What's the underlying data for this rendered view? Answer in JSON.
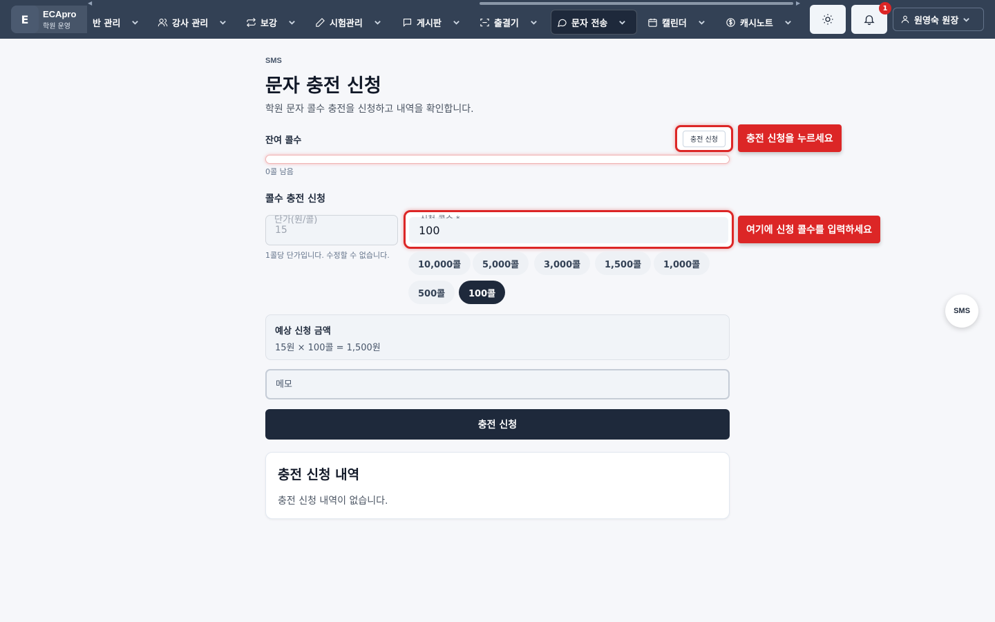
{
  "app": {
    "logo_letter": "E",
    "name": "ECApro",
    "subtitle": "학원 운영",
    "nav_left_arrow": "◀",
    "nav_right_arrow": "▶"
  },
  "nav": {
    "items": [
      {
        "label": "반 관리",
        "icon": "class-icon"
      },
      {
        "label": "강사 관리",
        "icon": "users-icon"
      },
      {
        "label": "보강",
        "icon": "repeat-icon"
      },
      {
        "label": "시험관리",
        "icon": "pencil-icon"
      },
      {
        "label": "게시판",
        "icon": "chat-square-icon"
      },
      {
        "label": "출결기",
        "icon": "scan-icon"
      },
      {
        "label": "문자 전송",
        "icon": "message-icon",
        "active": true
      },
      {
        "label": "캘린더",
        "icon": "calendar-icon"
      },
      {
        "label": "캐시노트",
        "icon": "dollar-icon"
      }
    ],
    "notification_count": "1",
    "user_name": "원영숙 원장"
  },
  "page": {
    "eyebrow": "SMS",
    "title": "문자 충전 신청",
    "description": "학원 문자 콜수 충전을 신청하고 내역을 확인합니다."
  },
  "balance": {
    "label": "잔여 콜수",
    "button_label": "충전 신청",
    "remaining_text": "0콜 남음",
    "fill_percent": 0
  },
  "callouts": {
    "top": "충전 신청을 누르세요",
    "input": "여기에 신청 콜수를 입력하세요"
  },
  "form": {
    "section_title": "콜수 충전 신청",
    "unit_price_label": "단가(원/콜)",
    "unit_price_value": "15",
    "unit_price_help": "1콜당 단가입니다. 수정할 수 없습니다.",
    "count_label": "신청 콜수 *",
    "count_value": "100",
    "presets": [
      "10,000콜",
      "5,000콜",
      "3,000콜",
      "1,500콜",
      "1,000콜",
      "500콜",
      "100콜"
    ],
    "selected_preset": "100콜",
    "estimate_title": "예상 신청 금액",
    "estimate_value": "15원 × 100콜 = 1,500원",
    "memo_placeholder": "메모",
    "submit_label": "충전 신청"
  },
  "history": {
    "title": "충전 신청 내역",
    "empty_text": "충전 신청 내역이 없습니다."
  },
  "fab": {
    "label": "SMS"
  },
  "colors": {
    "nav_bg": "#334155",
    "primary": "#1e293b",
    "accent": "#dc2626",
    "page_bg": "#f6f7fa"
  }
}
